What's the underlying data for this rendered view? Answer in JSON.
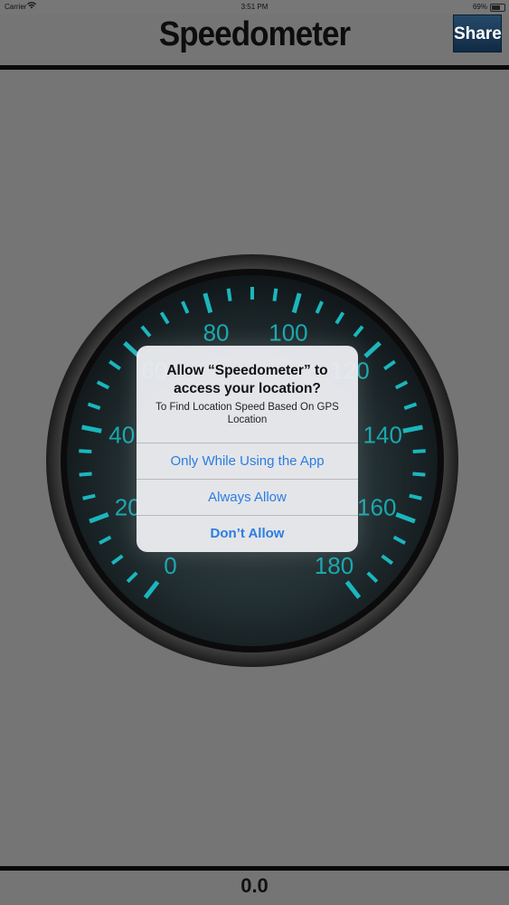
{
  "status_bar": {
    "carrier": "Carrier",
    "time": "3:51 PM",
    "battery": "69%",
    "battery_level": 0.69
  },
  "nav": {
    "title": "Speedometer",
    "share_label": "Share"
  },
  "gauge": {
    "labels": [
      "0",
      "20",
      "40",
      "60",
      "80",
      "100",
      "120",
      "140",
      "160",
      "180"
    ],
    "tick_color": "#1bb6bd",
    "label_color": "#19a8ae"
  },
  "alert": {
    "title": "Allow “Speedometer” to access your location?",
    "message": "To Find Location Speed Based On GPS Location",
    "buttons": [
      "Only While Using the App",
      "Always Allow",
      "Don’t Allow"
    ],
    "button_color": "#2b7de0"
  },
  "readout": {
    "speed": "0.0"
  }
}
